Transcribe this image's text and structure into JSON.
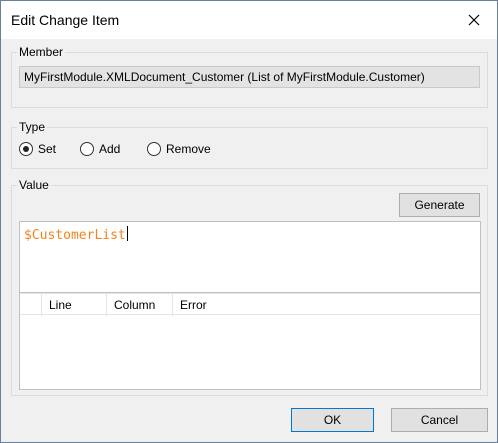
{
  "window": {
    "title": "Edit Change Item"
  },
  "member": {
    "legend": "Member",
    "value": "MyFirstModule.XMLDocument_Customer (List of MyFirstModule.Customer)"
  },
  "type": {
    "legend": "Type",
    "options": [
      {
        "label": "Set",
        "selected": true
      },
      {
        "label": "Add",
        "selected": false
      },
      {
        "label": "Remove",
        "selected": false
      }
    ]
  },
  "value": {
    "legend": "Value",
    "generate_label": "Generate",
    "expression": "$CustomerList",
    "expression_color": "#f5821f",
    "columns": [
      "",
      "Line",
      "Column",
      "Error"
    ]
  },
  "footer": {
    "ok_label": "OK",
    "cancel_label": "Cancel"
  }
}
